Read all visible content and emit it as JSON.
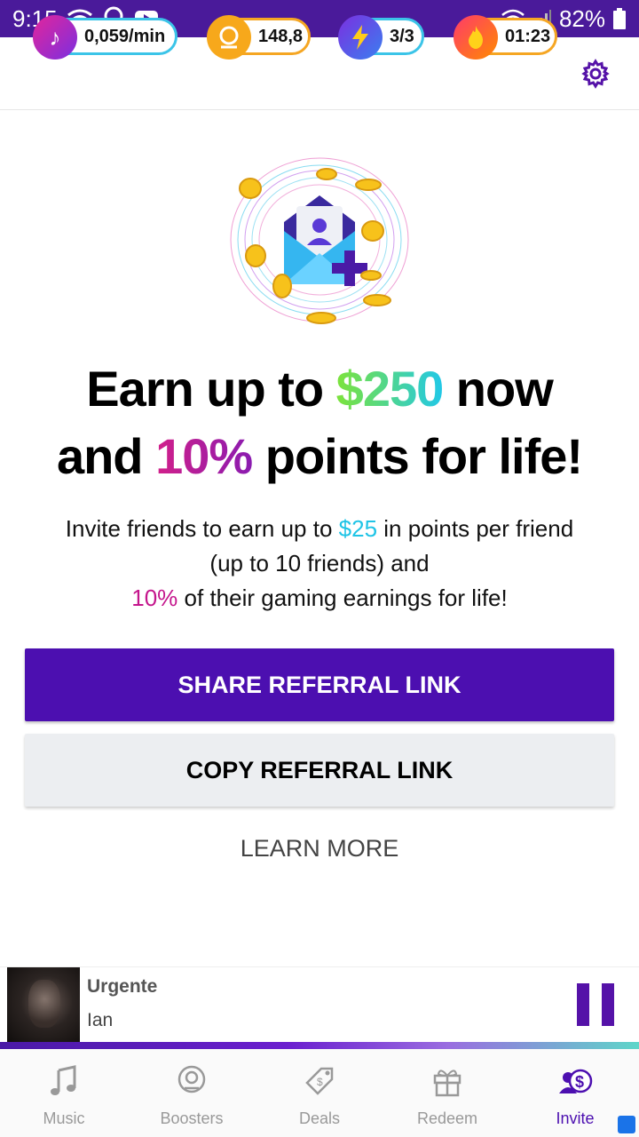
{
  "status_bar": {
    "time": "9:15",
    "battery": "82%"
  },
  "stats": {
    "music_rate": "0,059/min",
    "coins": "148,8",
    "boosters": "3/3",
    "timer": "01:23"
  },
  "headline": {
    "line1_pre": "Earn up to ",
    "amount": "$250",
    "line1_post": " now",
    "line2_pre": "and ",
    "percent": "10%",
    "line2_post": " points for life!"
  },
  "subtext": {
    "part1": "Invite friends to earn up to ",
    "amount": "$25",
    "part2": " in points per friend (up to 10 friends) and",
    "percent": "10%",
    "part3": " of their gaming earnings for life!"
  },
  "buttons": {
    "share": "SHARE REFERRAL LINK",
    "copy": "COPY REFERRAL LINK",
    "learn_more": "LEARN MORE"
  },
  "player": {
    "track": "Urgente",
    "artist": "Ian",
    "progress": 1.0
  },
  "nav": {
    "items": [
      {
        "label": "Music",
        "icon": "music-note-icon"
      },
      {
        "label": "Boosters",
        "icon": "coin-icon"
      },
      {
        "label": "Deals",
        "icon": "tag-icon"
      },
      {
        "label": "Redeem",
        "icon": "gift-icon"
      },
      {
        "label": "Invite",
        "icon": "invite-dollar-icon",
        "active": true
      }
    ]
  },
  "colors": {
    "primary": "#4c0fb0",
    "status_bar": "#4a1a9a",
    "accent_green": "#7ce33b",
    "accent_cyan": "#1fc4e6",
    "accent_pink": "#c4158c"
  }
}
